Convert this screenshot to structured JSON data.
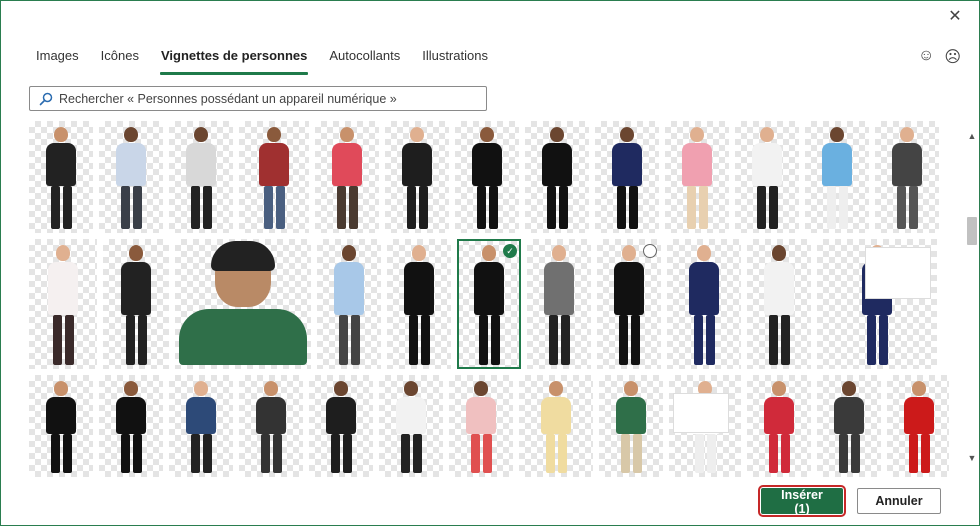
{
  "window": {
    "close_icon": "close-icon"
  },
  "tabs": [
    {
      "label": "Images",
      "active": false
    },
    {
      "label": "Icônes",
      "active": false
    },
    {
      "label": "Vignettes de personnes",
      "active": true
    },
    {
      "label": "Autocollants",
      "active": false
    },
    {
      "label": "Illustrations",
      "active": false
    }
  ],
  "feedback": {
    "happy_icon": "smile-icon",
    "sad_icon": "frown-icon"
  },
  "search": {
    "placeholder": "Rechercher « Personnes possédant un appareil numérique »",
    "value": "",
    "icon": "search-icon"
  },
  "gallery": {
    "row1": [
      {
        "skin": "#c8916b",
        "top": "#222222",
        "bottom": "#222222"
      },
      {
        "skin": "#6b4630",
        "top": "#c9d6e8",
        "bottom": "#3a3f48"
      },
      {
        "skin": "#6b4630",
        "top": "#d8d8d8",
        "bottom": "#222222"
      },
      {
        "skin": "#8a5a3c",
        "top": "#a03030",
        "bottom": "#4a5f80"
      },
      {
        "skin": "#c8916b",
        "top": "#e04a5a",
        "bottom": "#4a3a30"
      },
      {
        "skin": "#e0b090",
        "top": "#1e1e1e",
        "bottom": "#1e1e1e"
      },
      {
        "skin": "#8a5a3c",
        "top": "#111111",
        "bottom": "#111111"
      },
      {
        "skin": "#6b4630",
        "top": "#111111",
        "bottom": "#111111"
      },
      {
        "skin": "#6b4630",
        "top": "#1f2a60",
        "bottom": "#111111"
      },
      {
        "skin": "#e0b090",
        "top": "#f0a0b0",
        "bottom": "#e8d0b0"
      },
      {
        "skin": "#e0b090",
        "top": "#f2f2f2",
        "bottom": "#222222"
      },
      {
        "skin": "#6b4630",
        "top": "#6ab0e0",
        "bottom": "#eeeeee"
      },
      {
        "skin": "#e0b090",
        "top": "#444444",
        "bottom": "#555555"
      }
    ],
    "row2": [
      {
        "skin": "#e0b090",
        "top": "#f5f0f0",
        "bottom": "#3a2a2a"
      },
      {
        "skin": "#8a5a3c",
        "top": "#222222",
        "bottom": "#222222"
      },
      {
        "type": "closeup",
        "label": ""
      },
      {
        "skin": "#6b4630",
        "top": "#a8c8e8",
        "bottom": "#444444"
      },
      {
        "skin": "#e0b090",
        "top": "#111111",
        "bottom": "#111111"
      },
      {
        "skin": "#c8916b",
        "top": "#111111",
        "bottom": "#111111",
        "selected": true
      },
      {
        "skin": "#e0b090",
        "top": "#707070",
        "bottom": "#222222"
      },
      {
        "skin": "#e0b090",
        "top": "#111111",
        "bottom": "#111111",
        "hover": true
      },
      {
        "skin": "#e0b090",
        "top": "#1f2a60",
        "bottom": "#1f2a60"
      },
      {
        "skin": "#6b4630",
        "top": "#f2f2f2",
        "bottom": "#222222"
      },
      {
        "skin": "#e0b090",
        "top": "#1f2a60",
        "bottom": "#1f2a60",
        "board": true
      }
    ],
    "row3": [
      {
        "skin": "#c8916b",
        "top": "#111111",
        "bottom": "#111111"
      },
      {
        "skin": "#8a5a3c",
        "top": "#111111",
        "bottom": "#111111"
      },
      {
        "skin": "#e0b090",
        "top": "#2d4a78",
        "bottom": "#222222"
      },
      {
        "skin": "#c8916b",
        "top": "#333333",
        "bottom": "#333333"
      },
      {
        "skin": "#6b4630",
        "top": "#1e1e1e",
        "bottom": "#1e1e1e"
      },
      {
        "skin": "#6b4630",
        "top": "#f2f2f2",
        "bottom": "#222222"
      },
      {
        "skin": "#6b4630",
        "top": "#f0c0c0",
        "bottom": "#e05050"
      },
      {
        "skin": "#c8916b",
        "top": "#f0dca0",
        "bottom": "#f0dca0"
      },
      {
        "skin": "#c8916b",
        "top": "#2f6f49",
        "bottom": "#d8c8a8"
      },
      {
        "skin": "#e0b090",
        "top": "#ffffff",
        "bottom": "#eeeeee",
        "board": true
      },
      {
        "skin": "#c8916b",
        "top": "#d02a3a",
        "bottom": "#d02a3a"
      },
      {
        "skin": "#6b4630",
        "top": "#3a3a3a",
        "bottom": "#3a3a3a"
      },
      {
        "skin": "#c8916b",
        "top": "#cc1a1a",
        "bottom": "#cc1a1a"
      }
    ]
  },
  "footer": {
    "insert_label": "Insérer (1)",
    "cancel_label": "Annuler"
  }
}
